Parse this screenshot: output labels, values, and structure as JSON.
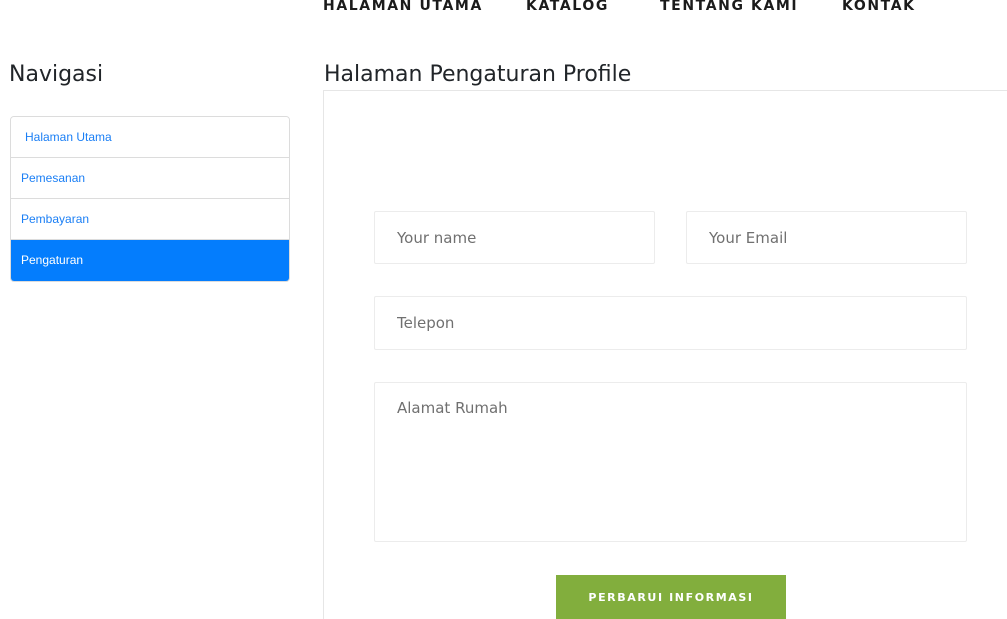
{
  "topnav": {
    "items": [
      {
        "label": "HALAMAN UTAMA"
      },
      {
        "label": "KATALOG"
      },
      {
        "label": "TENTANG KAMI"
      },
      {
        "label": "KONTAK"
      }
    ]
  },
  "sidebar": {
    "heading": "Navigasi",
    "items": [
      {
        "label": "Halaman Utama",
        "active": false
      },
      {
        "label": "Pemesanan",
        "active": false
      },
      {
        "label": "Pembayaran",
        "active": false
      },
      {
        "label": "Pengaturan",
        "active": true
      }
    ]
  },
  "main": {
    "heading": "Halaman Pengaturan Profile",
    "form": {
      "name_placeholder": "Your name",
      "email_placeholder": "Your Email",
      "phone_placeholder": "Telepon",
      "address_placeholder": "Alamat Rumah",
      "submit_label": "PERBARUI INFORMASI"
    }
  },
  "colors": {
    "active_item": "#047dfd",
    "link": "#1b7ff5",
    "submit_button": "#82ae3d"
  }
}
